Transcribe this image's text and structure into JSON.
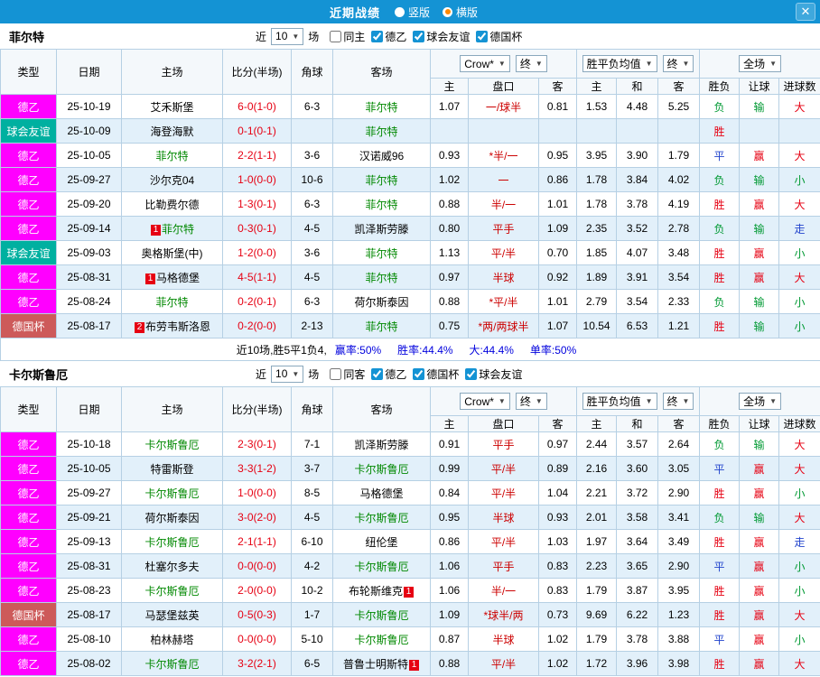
{
  "icons": {
    "chevron_down": "▼",
    "close": "✕"
  },
  "colors": {
    "titlebar_bg": "#1493d4",
    "radio_selected": "#ff8a00",
    "league": {
      "dey": "#ff00ff",
      "fri": "#00b0a0",
      "cup": "#cd5a5a"
    },
    "win": "#e60012",
    "loss": "#009933",
    "draw": "#2244cc",
    "focus_team": "#008800",
    "score": "#e60012",
    "handicap_line": "#cc0000",
    "summary_stat": "#0000dd",
    "row_alt_bg": "#e2f0fa"
  },
  "header": {
    "title": "近期战绩",
    "layout_options": [
      {
        "label": "竖版",
        "selected": false
      },
      {
        "label": "横版",
        "selected": true
      }
    ]
  },
  "table_headers": {
    "main": [
      "类型",
      "日期",
      "主场",
      "比分(半场)",
      "角球",
      "客场"
    ],
    "company": "Crow*",
    "final": "终",
    "avg": "胜平负均值",
    "scope": "全场",
    "sub": [
      "主",
      "盘口",
      "客",
      "主",
      "和",
      "客",
      "胜负",
      "让球",
      "进球数"
    ]
  },
  "sections": [
    {
      "team": "菲尔特",
      "filter": {
        "near": "近",
        "count": "10",
        "unit": "场",
        "checkboxes": [
          {
            "label": "同主",
            "checked": false
          },
          {
            "label": "德乙",
            "checked": true
          },
          {
            "label": "球会友谊",
            "checked": true
          },
          {
            "label": "德国杯",
            "checked": true
          }
        ]
      },
      "rows": [
        {
          "league": "德乙",
          "lc": "dey",
          "date": "25-10-19",
          "home": {
            "name": "艾禾斯堡"
          },
          "score": "6-0(1-0)",
          "corner": "6-3",
          "away": {
            "name": "菲尔特",
            "focus": true
          },
          "odds": [
            "1.07",
            "一/球半",
            "0.81"
          ],
          "euro": [
            "1.53",
            "4.48",
            "5.25"
          ],
          "result": {
            "t": "负",
            "c": "loss"
          },
          "handicap": {
            "t": "输",
            "c": "loss"
          },
          "goal": {
            "t": "大",
            "c": "win"
          }
        },
        {
          "league": "球会友谊",
          "lc": "fri",
          "date": "25-10-09",
          "home": {
            "name": "海登海默"
          },
          "score": "0-1(0-1)",
          "corner": "",
          "away": {
            "name": "菲尔特",
            "focus": true
          },
          "odds": [
            "",
            "",
            ""
          ],
          "euro": [
            "",
            "",
            ""
          ],
          "result": {
            "t": "胜",
            "c": "win"
          },
          "handicap": {
            "t": ""
          },
          "goal": {
            "t": ""
          }
        },
        {
          "league": "德乙",
          "lc": "dey",
          "date": "25-10-05",
          "home": {
            "name": "菲尔特",
            "focus": true
          },
          "score": "2-2(1-1)",
          "corner": "3-6",
          "away": {
            "name": "汉诺威96"
          },
          "odds": [
            "0.93",
            "*半/一",
            "0.95"
          ],
          "euro": [
            "3.95",
            "3.90",
            "1.79"
          ],
          "result": {
            "t": "平",
            "c": "draw"
          },
          "handicap": {
            "t": "赢",
            "c": "win"
          },
          "goal": {
            "t": "大",
            "c": "win"
          }
        },
        {
          "league": "德乙",
          "lc": "dey",
          "date": "25-09-27",
          "home": {
            "name": "沙尔克04"
          },
          "score": "1-0(0-0)",
          "corner": "10-6",
          "away": {
            "name": "菲尔特",
            "focus": true
          },
          "odds": [
            "1.02",
            "一",
            "0.86"
          ],
          "euro": [
            "1.78",
            "3.84",
            "4.02"
          ],
          "result": {
            "t": "负",
            "c": "loss"
          },
          "handicap": {
            "t": "输",
            "c": "loss"
          },
          "goal": {
            "t": "小",
            "c": "loss"
          }
        },
        {
          "league": "德乙",
          "lc": "dey",
          "date": "25-09-20",
          "home": {
            "name": "比勒费尔德"
          },
          "score": "1-3(0-1)",
          "corner": "6-3",
          "away": {
            "name": "菲尔特",
            "focus": true
          },
          "odds": [
            "0.88",
            "半/一",
            "1.01"
          ],
          "euro": [
            "1.78",
            "3.78",
            "4.19"
          ],
          "result": {
            "t": "胜",
            "c": "win"
          },
          "handicap": {
            "t": "赢",
            "c": "win"
          },
          "goal": {
            "t": "大",
            "c": "win"
          }
        },
        {
          "league": "德乙",
          "lc": "dey",
          "date": "25-09-14",
          "home": {
            "name": "菲尔特",
            "focus": true,
            "badge": "1",
            "badge_pos": "before"
          },
          "score": "0-3(0-1)",
          "corner": "4-5",
          "away": {
            "name": "凯泽斯劳滕"
          },
          "odds": [
            "0.80",
            "平手",
            "1.09"
          ],
          "euro": [
            "2.35",
            "3.52",
            "2.78"
          ],
          "result": {
            "t": "负",
            "c": "loss"
          },
          "handicap": {
            "t": "输",
            "c": "loss"
          },
          "goal": {
            "t": "走",
            "c": "draw"
          }
        },
        {
          "league": "球会友谊",
          "lc": "fri",
          "date": "25-09-03",
          "home": {
            "name": "奥格斯堡(中)"
          },
          "score": "1-2(0-0)",
          "corner": "3-6",
          "away": {
            "name": "菲尔特",
            "focus": true
          },
          "odds": [
            "1.13",
            "平/半",
            "0.70"
          ],
          "euro": [
            "1.85",
            "4.07",
            "3.48"
          ],
          "result": {
            "t": "胜",
            "c": "win"
          },
          "handicap": {
            "t": "赢",
            "c": "win"
          },
          "goal": {
            "t": "小",
            "c": "loss"
          }
        },
        {
          "league": "德乙",
          "lc": "dey",
          "date": "25-08-31",
          "home": {
            "name": "马格德堡",
            "badge": "1",
            "badge_pos": "before"
          },
          "score": "4-5(1-1)",
          "corner": "4-5",
          "away": {
            "name": "菲尔特",
            "focus": true
          },
          "odds": [
            "0.97",
            "半球",
            "0.92"
          ],
          "euro": [
            "1.89",
            "3.91",
            "3.54"
          ],
          "result": {
            "t": "胜",
            "c": "win"
          },
          "handicap": {
            "t": "赢",
            "c": "win"
          },
          "goal": {
            "t": "大",
            "c": "win"
          }
        },
        {
          "league": "德乙",
          "lc": "dey",
          "date": "25-08-24",
          "home": {
            "name": "菲尔特",
            "focus": true
          },
          "score": "0-2(0-1)",
          "corner": "6-3",
          "away": {
            "name": "荷尔斯泰因"
          },
          "odds": [
            "0.88",
            "*平/半",
            "1.01"
          ],
          "euro": [
            "2.79",
            "3.54",
            "2.33"
          ],
          "result": {
            "t": "负",
            "c": "loss"
          },
          "handicap": {
            "t": "输",
            "c": "loss"
          },
          "goal": {
            "t": "小",
            "c": "loss"
          }
        },
        {
          "league": "德国杯",
          "lc": "cup",
          "date": "25-08-17",
          "home": {
            "name": "布劳韦斯洛恩",
            "badge": "2",
            "badge_pos": "before"
          },
          "score": "0-2(0-0)",
          "corner": "2-13",
          "away": {
            "name": "菲尔特",
            "focus": true
          },
          "odds": [
            "0.75",
            "*两/两球半",
            "1.07"
          ],
          "euro": [
            "10.54",
            "6.53",
            "1.21"
          ],
          "result": {
            "t": "胜",
            "c": "win"
          },
          "handicap": {
            "t": "输",
            "c": "loss"
          },
          "goal": {
            "t": "小",
            "c": "loss"
          }
        }
      ],
      "summary": {
        "prefix": "近10场,胜5平1负4,",
        "stats": [
          "赢率:50%",
          "胜率:44.4%",
          "大:44.4%",
          "单率:50%"
        ]
      }
    },
    {
      "team": "卡尔斯鲁厄",
      "filter": {
        "near": "近",
        "count": "10",
        "unit": "场",
        "checkboxes": [
          {
            "label": "同客",
            "checked": false
          },
          {
            "label": "德乙",
            "checked": true
          },
          {
            "label": "德国杯",
            "checked": true
          },
          {
            "label": "球会友谊",
            "checked": true
          }
        ]
      },
      "rows": [
        {
          "league": "德乙",
          "lc": "dey",
          "date": "25-10-18",
          "home": {
            "name": "卡尔斯鲁厄",
            "focus": true
          },
          "score": "2-3(0-1)",
          "corner": "7-1",
          "away": {
            "name": "凯泽斯劳滕"
          },
          "odds": [
            "0.91",
            "平手",
            "0.97"
          ],
          "euro": [
            "2.44",
            "3.57",
            "2.64"
          ],
          "result": {
            "t": "负",
            "c": "loss"
          },
          "handicap": {
            "t": "输",
            "c": "loss"
          },
          "goal": {
            "t": "大",
            "c": "win"
          }
        },
        {
          "league": "德乙",
          "lc": "dey",
          "date": "25-10-05",
          "home": {
            "name": "特雷斯登"
          },
          "score": "3-3(1-2)",
          "corner": "3-7",
          "away": {
            "name": "卡尔斯鲁厄",
            "focus": true
          },
          "odds": [
            "0.99",
            "平/半",
            "0.89"
          ],
          "euro": [
            "2.16",
            "3.60",
            "3.05"
          ],
          "result": {
            "t": "平",
            "c": "draw"
          },
          "handicap": {
            "t": "赢",
            "c": "win"
          },
          "goal": {
            "t": "大",
            "c": "win"
          }
        },
        {
          "league": "德乙",
          "lc": "dey",
          "date": "25-09-27",
          "home": {
            "name": "卡尔斯鲁厄",
            "focus": true
          },
          "score": "1-0(0-0)",
          "corner": "8-5",
          "away": {
            "name": "马格德堡"
          },
          "odds": [
            "0.84",
            "平/半",
            "1.04"
          ],
          "euro": [
            "2.21",
            "3.72",
            "2.90"
          ],
          "result": {
            "t": "胜",
            "c": "win"
          },
          "handicap": {
            "t": "赢",
            "c": "win"
          },
          "goal": {
            "t": "小",
            "c": "loss"
          }
        },
        {
          "league": "德乙",
          "lc": "dey",
          "date": "25-09-21",
          "home": {
            "name": "荷尔斯泰因"
          },
          "score": "3-0(2-0)",
          "corner": "4-5",
          "away": {
            "name": "卡尔斯鲁厄",
            "focus": true
          },
          "odds": [
            "0.95",
            "半球",
            "0.93"
          ],
          "euro": [
            "2.01",
            "3.58",
            "3.41"
          ],
          "result": {
            "t": "负",
            "c": "loss"
          },
          "handicap": {
            "t": "输",
            "c": "loss"
          },
          "goal": {
            "t": "大",
            "c": "win"
          }
        },
        {
          "league": "德乙",
          "lc": "dey",
          "date": "25-09-13",
          "home": {
            "name": "卡尔斯鲁厄",
            "focus": true
          },
          "score": "2-1(1-1)",
          "corner": "6-10",
          "away": {
            "name": "纽伦堡"
          },
          "odds": [
            "0.86",
            "平/半",
            "1.03"
          ],
          "euro": [
            "1.97",
            "3.64",
            "3.49"
          ],
          "result": {
            "t": "胜",
            "c": "win"
          },
          "handicap": {
            "t": "赢",
            "c": "win"
          },
          "goal": {
            "t": "走",
            "c": "draw"
          }
        },
        {
          "league": "德乙",
          "lc": "dey",
          "date": "25-08-31",
          "home": {
            "name": "杜塞尔多夫"
          },
          "score": "0-0(0-0)",
          "corner": "4-2",
          "away": {
            "name": "卡尔斯鲁厄",
            "focus": true
          },
          "odds": [
            "1.06",
            "平手",
            "0.83"
          ],
          "euro": [
            "2.23",
            "3.65",
            "2.90"
          ],
          "result": {
            "t": "平",
            "c": "draw"
          },
          "handicap": {
            "t": "赢",
            "c": "win"
          },
          "goal": {
            "t": "小",
            "c": "loss"
          }
        },
        {
          "league": "德乙",
          "lc": "dey",
          "date": "25-08-23",
          "home": {
            "name": "卡尔斯鲁厄",
            "focus": true
          },
          "score": "2-0(0-0)",
          "corner": "10-2",
          "away": {
            "name": "布轮斯维克",
            "badge": "1",
            "badge_pos": "after"
          },
          "odds": [
            "1.06",
            "半/一",
            "0.83"
          ],
          "euro": [
            "1.79",
            "3.87",
            "3.95"
          ],
          "result": {
            "t": "胜",
            "c": "win"
          },
          "handicap": {
            "t": "赢",
            "c": "win"
          },
          "goal": {
            "t": "小",
            "c": "loss"
          }
        },
        {
          "league": "德国杯",
          "lc": "cup",
          "date": "25-08-17",
          "home": {
            "name": "马瑟堡兹英"
          },
          "score": "0-5(0-3)",
          "corner": "1-7",
          "away": {
            "name": "卡尔斯鲁厄",
            "focus": true
          },
          "odds": [
            "1.09",
            "*球半/两",
            "0.73"
          ],
          "euro": [
            "9.69",
            "6.22",
            "1.23"
          ],
          "result": {
            "t": "胜",
            "c": "win"
          },
          "handicap": {
            "t": "赢",
            "c": "win"
          },
          "goal": {
            "t": "大",
            "c": "win"
          }
        },
        {
          "league": "德乙",
          "lc": "dey",
          "date": "25-08-10",
          "home": {
            "name": "柏林赫塔"
          },
          "score": "0-0(0-0)",
          "corner": "5-10",
          "away": {
            "name": "卡尔斯鲁厄",
            "focus": true
          },
          "odds": [
            "0.87",
            "半球",
            "1.02"
          ],
          "euro": [
            "1.79",
            "3.78",
            "3.88"
          ],
          "result": {
            "t": "平",
            "c": "draw"
          },
          "handicap": {
            "t": "赢",
            "c": "win"
          },
          "goal": {
            "t": "小",
            "c": "loss"
          }
        },
        {
          "league": "德乙",
          "lc": "dey",
          "date": "25-08-02",
          "home": {
            "name": "卡尔斯鲁厄",
            "focus": true
          },
          "score": "3-2(2-1)",
          "corner": "6-5",
          "away": {
            "name": "普鲁士明斯特",
            "badge": "1",
            "badge_pos": "after"
          },
          "odds": [
            "0.88",
            "平/半",
            "1.02"
          ],
          "euro": [
            "1.72",
            "3.96",
            "3.98"
          ],
          "result": {
            "t": "胜",
            "c": "win"
          },
          "handicap": {
            "t": "赢",
            "c": "win"
          },
          "goal": {
            "t": "大",
            "c": "win"
          }
        }
      ]
    }
  ]
}
